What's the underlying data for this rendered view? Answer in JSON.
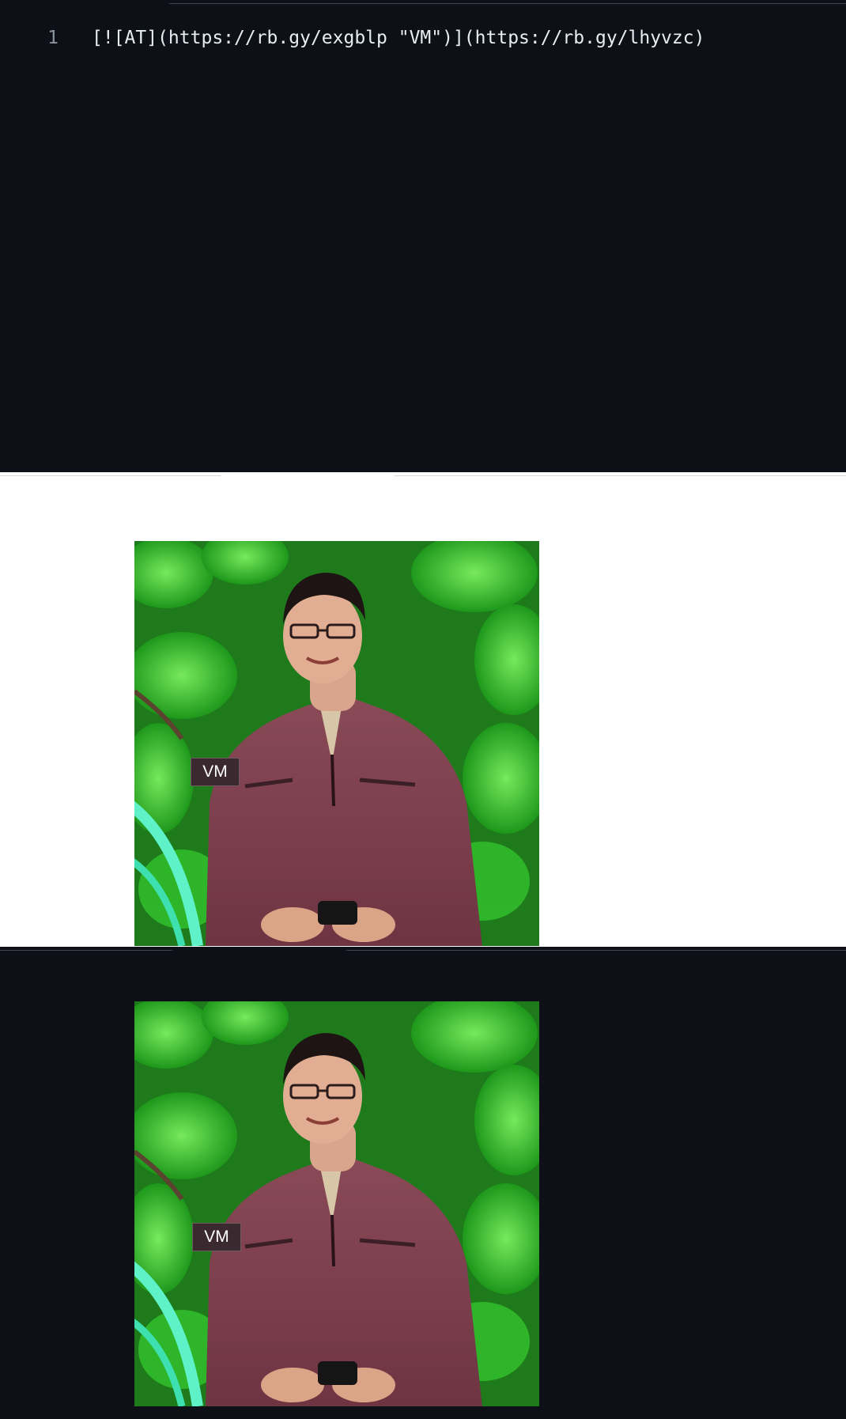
{
  "editor": {
    "lines": [
      {
        "number": "1",
        "code": "[![AT](https://rb.gy/exgblp \"VM\")](https://rb.gy/lhyvzc)"
      }
    ]
  },
  "preview": {
    "image_alt": "AT",
    "image_title": "VM",
    "link_href": "https://rb.gy/lhyvzc",
    "tooltip": "VM"
  },
  "colors": {
    "dark_bg": "#0d1117",
    "light_bg": "#ffffff",
    "code_text": "#e6edf3",
    "line_number": "#8b949e",
    "foliage": "#3fd13a",
    "shirt": "#7a3e4c"
  }
}
